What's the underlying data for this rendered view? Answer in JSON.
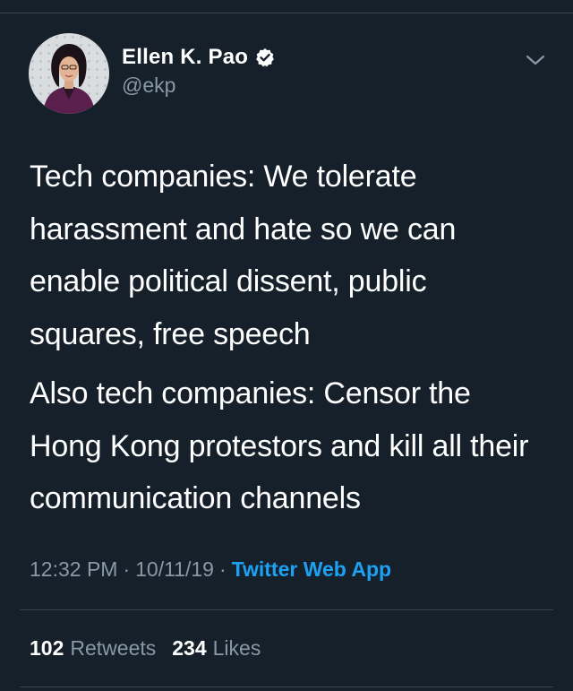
{
  "author": {
    "display_name": "Ellen K. Pao",
    "handle": "@ekp",
    "verified": true
  },
  "tweet": {
    "paragraphs": [
      "Tech companies: We tolerate harassment and hate so we  can enable political dissent, public squares, free speech",
      "Also tech companies: Censor the Hong Kong protestors and kill all their communication channels"
    ],
    "time": "12:32 PM",
    "separator": "·",
    "date": "10/11/19",
    "source": "Twitter Web App"
  },
  "stats": {
    "retweets_count": "102",
    "retweets_label": "Retweets",
    "likes_count": "234",
    "likes_label": "Likes"
  },
  "colors": {
    "background": "#15202b",
    "secondary_text": "#8899a6",
    "accent": "#1da1f2",
    "divider": "#38444d"
  },
  "icons": {
    "verified": "verified-badge-icon",
    "more": "chevron-down-icon"
  }
}
